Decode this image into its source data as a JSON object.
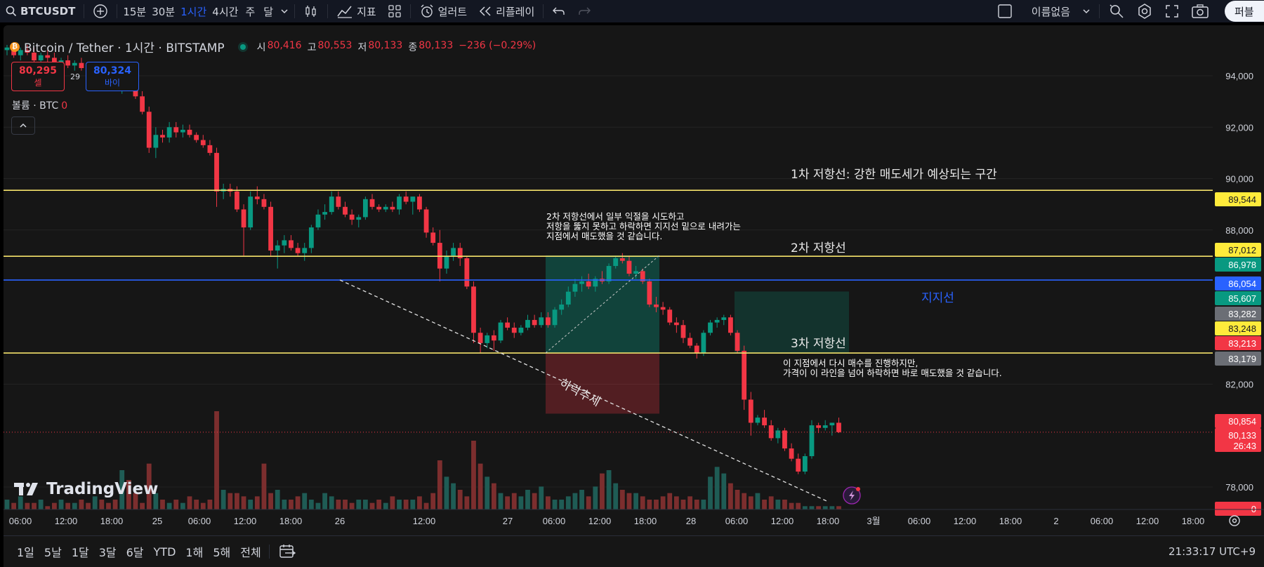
{
  "toolbar": {
    "symbol": "BTCUSDT",
    "intervals": [
      "15분",
      "30분",
      "1시간",
      "4시간",
      "주",
      "달"
    ],
    "active_interval": "1시간",
    "indicators_label": "지표",
    "alert_label": "얼러트",
    "replay_label": "리플레이",
    "layout_name": "이름없음",
    "publish_label": "퍼블"
  },
  "legend": {
    "title": "Bitcoin / Tether · 1시간 · BITSTAMP",
    "open_label": "시",
    "open": "80,416",
    "high_label": "고",
    "high": "80,553",
    "low_label": "저",
    "low": "80,133",
    "close_label": "종",
    "close": "80,133",
    "change": "−236 (−0.29%)"
  },
  "trade": {
    "sell_price": "80,295",
    "sell_label": "셀",
    "spread": "29",
    "buy_price": "80,324",
    "buy_label": "바이"
  },
  "volume_label": {
    "name": "볼륨 · BTC",
    "value": "0"
  },
  "logo_text": "TradingView",
  "annotations": {
    "res1": "1차 저항선: 강한 매도세가 예상되는 구간",
    "res2": "2차 저항선",
    "res3": "3차 저항선",
    "support": "지지선",
    "downtrend": "하락추세",
    "note1": [
      "2차 저항선에서 일부 익절을 시도하고",
      "저항을 뚫지 못하고 하락하면 지지선 밑으로 내려가는",
      "지점에서 매도했을 것 같습니다."
    ],
    "note2": [
      "이 지점에서 다시 매수를 진행하지만,",
      "가격이 이 라인을 넘어 하락하면 바로 매도했을 것 같습니다."
    ]
  },
  "colors": {
    "up": "#089981",
    "down": "#f23645",
    "upVol": "#1f5c55",
    "downVol": "#7c2e2e",
    "yellowLine": "#f5e36b",
    "blueLine": "#2962ff",
    "grid": "#232323",
    "longBox": "rgba(8,153,129,0.35)",
    "shortBox": "rgba(242,54,69,0.28)"
  },
  "chart_data": {
    "type": "candlestick",
    "symbol": "BTCUSDT",
    "y_ticks": [
      "94,000",
      "92,000",
      "90,000",
      "88,000",
      "82,000",
      "78,000"
    ],
    "y_tick_values": [
      94000,
      92000,
      90000,
      88000,
      82000,
      78000
    ],
    "ylim": [
      77000,
      95000
    ],
    "x_ticks": [
      "06:00",
      "12:00",
      "18:00",
      "25",
      "06:00",
      "12:00",
      "18:00",
      "26",
      "12:00",
      "27",
      "06:00",
      "12:00",
      "18:00",
      "28",
      "06:00",
      "12:00",
      "18:00",
      "3월",
      "06:00",
      "12:00",
      "18:00",
      "2",
      "06:00",
      "12:00",
      "18:00"
    ],
    "price_tags": [
      {
        "label": "89,544",
        "value": 89544,
        "kind": "yellow"
      },
      {
        "label": "87,012",
        "value": 87012,
        "kind": "yellow"
      },
      {
        "label": "86,978",
        "value": 86978,
        "kind": "green"
      },
      {
        "label": "86,054",
        "value": 86054,
        "kind": "blue"
      },
      {
        "label": "85,607",
        "value": 85607,
        "kind": "green"
      },
      {
        "label": "83,282",
        "value": 83282,
        "kind": "gray"
      },
      {
        "label": "83,248",
        "value": 83248,
        "kind": "yellow"
      },
      {
        "label": "83,213",
        "value": 83213,
        "kind": "red"
      },
      {
        "label": "83,179",
        "value": 83179,
        "kind": "gray"
      },
      {
        "label": "80,854",
        "value": 80854,
        "kind": "red"
      },
      {
        "label": "80,133",
        "value": 80133,
        "kind": "red",
        "sub": "26:43"
      },
      {
        "label": "0",
        "value": 77380,
        "kind": "red"
      }
    ],
    "levels": [
      {
        "name": "1차 저항선",
        "value": 89544,
        "color": "yellow"
      },
      {
        "name": "2차 저항선",
        "value": 86978,
        "color": "yellow"
      },
      {
        "name": "지지선",
        "value": 86054,
        "color": "blue"
      },
      {
        "name": "3차 저항선",
        "value": 83213,
        "color": "yellow"
      }
    ],
    "candles": [
      [
        95000,
        95200,
        94800,
        95100
      ],
      [
        95100,
        95300,
        94700,
        94800
      ],
      [
        94800,
        95100,
        94600,
        95000
      ],
      [
        95000,
        95200,
        94800,
        94900
      ],
      [
        94900,
        95100,
        94500,
        94600
      ],
      [
        94600,
        94900,
        94400,
        94800
      ],
      [
        94800,
        95000,
        94500,
        94700
      ],
      [
        94700,
        94900,
        94400,
        94500
      ],
      [
        94500,
        94700,
        94300,
        94600
      ],
      [
        94600,
        94800,
        94300,
        94400
      ],
      [
        94400,
        94600,
        94200,
        94500
      ],
      [
        94500,
        94700,
        94200,
        94300
      ],
      [
        94300,
        94500,
        94100,
        94200
      ],
      [
        94200,
        94400,
        94000,
        94300
      ],
      [
        94300,
        94500,
        94100,
        94200
      ],
      [
        94200,
        94300,
        93800,
        93900
      ],
      [
        93900,
        94100,
        93600,
        93700
      ],
      [
        93700,
        93900,
        93300,
        93800
      ],
      [
        93800,
        94000,
        93500,
        93600
      ],
      [
        93600,
        93800,
        93100,
        93200
      ],
      [
        93200,
        93400,
        92500,
        92600
      ],
      [
        92600,
        92800,
        91000,
        91200
      ],
      [
        91200,
        92000,
        90800,
        91700
      ],
      [
        91700,
        91900,
        91400,
        91600
      ],
      [
        91600,
        92200,
        91400,
        92000
      ],
      [
        92000,
        92200,
        91600,
        91800
      ],
      [
        91800,
        92100,
        91600,
        91900
      ],
      [
        91900,
        92100,
        91600,
        91700
      ],
      [
        91700,
        91800,
        91400,
        91500
      ],
      [
        91500,
        91700,
        91200,
        91300
      ],
      [
        91300,
        91500,
        90900,
        91000
      ],
      [
        91000,
        91200,
        88900,
        89500
      ],
      [
        89500,
        89800,
        89200,
        89600
      ],
      [
        89600,
        89800,
        89300,
        89500
      ],
      [
        89500,
        89700,
        88700,
        88800
      ],
      [
        88800,
        89000,
        87000,
        88100
      ],
      [
        88100,
        89500,
        88000,
        89300
      ],
      [
        89300,
        89700,
        89000,
        89200
      ],
      [
        89200,
        89400,
        88800,
        88900
      ],
      [
        88900,
        89100,
        87000,
        87200
      ],
      [
        87200,
        87600,
        86500,
        87400
      ],
      [
        87400,
        87800,
        87100,
        87600
      ],
      [
        87600,
        87800,
        87200,
        87300
      ],
      [
        87300,
        87500,
        87000,
        87100
      ],
      [
        87100,
        87500,
        86800,
        87300
      ],
      [
        87300,
        88200,
        87100,
        88100
      ],
      [
        88100,
        88800,
        88000,
        88600
      ],
      [
        88600,
        89000,
        88400,
        88700
      ],
      [
        88700,
        89500,
        88600,
        89300
      ],
      [
        89300,
        89500,
        88800,
        88900
      ],
      [
        88900,
        89100,
        88500,
        88600
      ],
      [
        88600,
        88800,
        88200,
        88400
      ],
      [
        88400,
        88600,
        88100,
        88500
      ],
      [
        88500,
        89300,
        88400,
        89200
      ],
      [
        89200,
        89400,
        88800,
        88900
      ],
      [
        88900,
        89000,
        88700,
        88800
      ],
      [
        88800,
        89000,
        88700,
        88900
      ],
      [
        88900,
        89100,
        88700,
        88800
      ],
      [
        88800,
        89400,
        88600,
        89300
      ],
      [
        89300,
        89500,
        89000,
        89100
      ],
      [
        89100,
        89300,
        88600,
        89300
      ],
      [
        89300,
        89400,
        88700,
        88800
      ],
      [
        88800,
        88900,
        87700,
        87900
      ],
      [
        87900,
        88100,
        87400,
        87500
      ],
      [
        87500,
        88000,
        86000,
        86500
      ],
      [
        86500,
        87200,
        86300,
        87000
      ],
      [
        87000,
        87500,
        86800,
        87300
      ],
      [
        87300,
        87500,
        86600,
        86900
      ],
      [
        86900,
        87000,
        85700,
        85800
      ],
      [
        85800,
        86000,
        83600,
        84000
      ],
      [
        84000,
        84200,
        83200,
        83600
      ],
      [
        83600,
        84000,
        83400,
        83900
      ],
      [
        83900,
        84100,
        83300,
        83700
      ],
      [
        83700,
        84500,
        83600,
        84400
      ],
      [
        84400,
        84600,
        84100,
        84200
      ],
      [
        84200,
        84400,
        83800,
        84000
      ],
      [
        84000,
        84300,
        83900,
        84200
      ],
      [
        84200,
        84700,
        84100,
        84500
      ],
      [
        84500,
        84700,
        84200,
        84300
      ],
      [
        84300,
        84800,
        84200,
        84600
      ],
      [
        84600,
        84800,
        84200,
        84300
      ],
      [
        84300,
        85000,
        84200,
        84900
      ],
      [
        84900,
        85300,
        84700,
        85100
      ],
      [
        85100,
        85800,
        85000,
        85600
      ],
      [
        85600,
        86100,
        85400,
        85900
      ],
      [
        85900,
        86200,
        85600,
        86000
      ],
      [
        86000,
        86300,
        85700,
        85800
      ],
      [
        85800,
        86200,
        85600,
        86100
      ],
      [
        86100,
        86400,
        85900,
        86000
      ],
      [
        86000,
        86700,
        85900,
        86600
      ],
      [
        86600,
        87000,
        86500,
        86900
      ],
      [
        86900,
        87100,
        86700,
        86800
      ],
      [
        86800,
        87000,
        86200,
        86300
      ],
      [
        86300,
        86600,
        86100,
        86400
      ],
      [
        86400,
        86500,
        85900,
        86000
      ],
      [
        86000,
        86100,
        85000,
        85100
      ],
      [
        85100,
        85400,
        84800,
        85000
      ],
      [
        85000,
        85200,
        84700,
        84900
      ],
      [
        84900,
        85000,
        84300,
        84400
      ],
      [
        84400,
        84600,
        84000,
        84300
      ],
      [
        84300,
        84500,
        83600,
        83800
      ],
      [
        83800,
        84000,
        83400,
        83500
      ],
      [
        83500,
        83600,
        83000,
        83200
      ],
      [
        83200,
        84100,
        83100,
        84000
      ],
      [
        84000,
        84500,
        83900,
        84400
      ],
      [
        84400,
        84600,
        84200,
        84500
      ],
      [
        84500,
        84700,
        84300,
        84600
      ],
      [
        84600,
        84700,
        83900,
        84000
      ],
      [
        84000,
        84100,
        83200,
        83300
      ],
      [
        83300,
        83500,
        81000,
        81400
      ],
      [
        81400,
        81700,
        80000,
        80500
      ],
      [
        80500,
        80800,
        80400,
        80700
      ],
      [
        80700,
        81000,
        80300,
        80400
      ],
      [
        80400,
        80600,
        79800,
        79900
      ],
      [
        79900,
        80300,
        79700,
        80200
      ],
      [
        80200,
        80300,
        79400,
        79500
      ],
      [
        79500,
        79700,
        79000,
        79100
      ],
      [
        79100,
        79300,
        78500,
        78600
      ],
      [
        78600,
        79300,
        78500,
        79200
      ],
      [
        79200,
        80600,
        79100,
        80400
      ],
      [
        80400,
        80500,
        80100,
        80300
      ],
      [
        80300,
        80600,
        80200,
        80400
      ],
      [
        80400,
        80500,
        80000,
        80500
      ],
      [
        80500,
        80700,
        80100,
        80133
      ]
    ],
    "volumes": [
      3,
      2,
      4,
      2,
      2,
      3,
      1,
      2,
      3,
      2,
      2,
      3,
      2,
      4,
      3,
      2,
      3,
      12,
      9,
      5,
      2,
      14,
      5,
      3,
      2,
      3,
      2,
      4,
      3,
      2,
      3,
      30,
      6,
      5,
      5,
      4,
      3,
      4,
      14,
      5,
      6,
      3,
      3,
      4,
      5,
      3,
      2,
      5,
      4,
      3,
      3,
      2,
      3,
      3,
      2,
      3,
      2,
      4,
      3,
      3,
      3,
      4,
      2,
      5,
      15,
      10,
      8,
      6,
      4,
      21,
      14,
      10,
      8,
      5,
      4,
      5,
      4,
      6,
      5,
      7,
      4,
      3,
      3,
      4,
      5,
      6,
      4,
      7,
      11,
      12,
      8,
      6,
      5,
      5,
      4,
      3,
      3,
      4,
      5,
      4,
      3,
      4,
      3,
      3,
      10,
      13,
      11,
      8,
      6,
      5,
      4,
      5,
      3,
      4,
      3,
      3,
      2,
      2,
      1,
      1
    ],
    "volume_max": 30
  }
}
